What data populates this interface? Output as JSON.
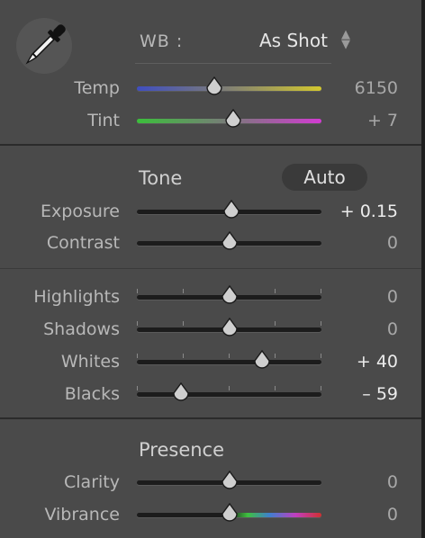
{
  "wb": {
    "label": "WB :",
    "value": "As Shot",
    "icon": "eyedropper-icon"
  },
  "colors": {
    "panel_bg": "#4a4a4a",
    "track_dark": "#1c1c1c",
    "label": "#b8b8b8",
    "value_bright": "#ececec"
  },
  "white_balance": [
    {
      "label": "Temp",
      "value": "6150",
      "level": 0.42
    },
    {
      "label": "Tint",
      "value": "+ 7",
      "level": 0.52
    }
  ],
  "tone": {
    "heading": "Tone",
    "auto_label": "Auto",
    "sliders": [
      {
        "label": "Exposure",
        "value": "+ 0.15",
        "level": 0.51
      },
      {
        "label": "Contrast",
        "value": "0",
        "level": 0.5
      }
    ],
    "region_sliders": [
      {
        "label": "Highlights",
        "value": "0",
        "level": 0.5
      },
      {
        "label": "Shadows",
        "value": "0",
        "level": 0.5
      },
      {
        "label": "Whites",
        "value": "+ 40",
        "level": 0.68
      },
      {
        "label": "Blacks",
        "value": "– 59",
        "level": 0.24
      }
    ]
  },
  "presence": {
    "heading": "Presence",
    "sliders": [
      {
        "label": "Clarity",
        "value": "0",
        "level": 0.5
      },
      {
        "label": "Vibrance",
        "value": "0",
        "level": 0.5
      }
    ]
  }
}
